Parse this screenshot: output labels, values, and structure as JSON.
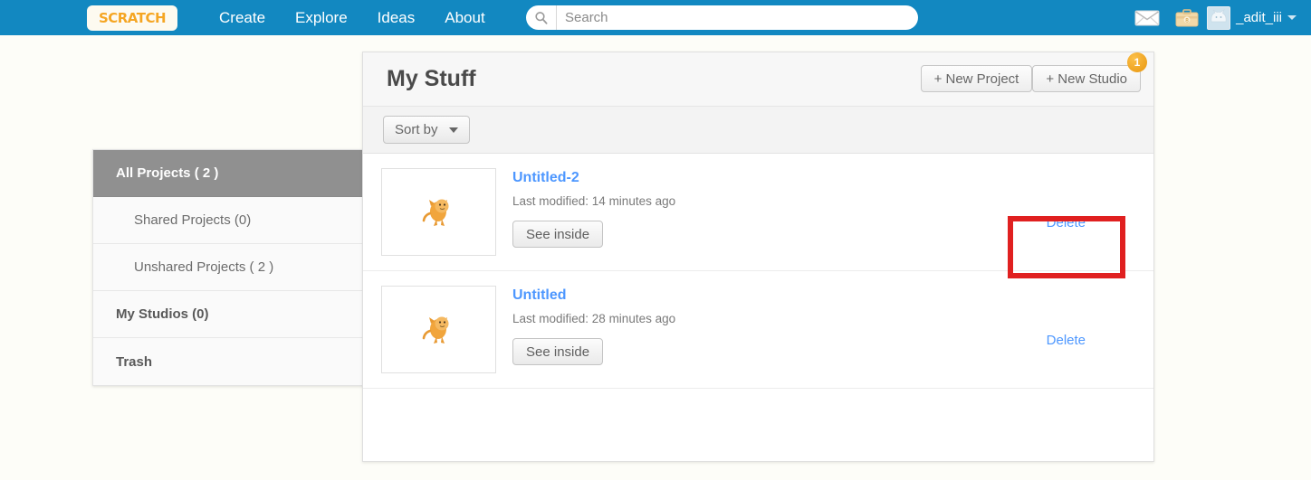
{
  "nav": {
    "logo_text": "SCRATCH",
    "logo_name": "scratch-logo",
    "links": [
      {
        "label": "Create"
      },
      {
        "label": "Explore"
      },
      {
        "label": "Ideas"
      },
      {
        "label": "About"
      }
    ],
    "search": {
      "placeholder": "Search",
      "value": "",
      "icon": "search-icon"
    },
    "messages_icon": "envelope-icon",
    "mystuff_icon": "briefcase-icon",
    "username": "_adit_iii",
    "avatar_icon": "avatar-cat-icon",
    "caret_icon": "chevron-down-icon"
  },
  "sidebar": {
    "items": [
      {
        "label": "All Projects ( 2 )",
        "selected": true,
        "indent": false,
        "bold": true
      },
      {
        "label": "Shared Projects (0)",
        "selected": false,
        "indent": true,
        "bold": false
      },
      {
        "label": "Unshared Projects ( 2 )",
        "selected": false,
        "indent": true,
        "bold": false
      },
      {
        "label": "My Studios (0)",
        "selected": false,
        "indent": false,
        "bold": true
      },
      {
        "label": "Trash",
        "selected": false,
        "indent": false,
        "bold": true
      }
    ]
  },
  "panel": {
    "title": "My Stuff",
    "new_project_label": "+ New Project",
    "new_studio_label": "+ New Studio",
    "studio_badge_count": "1",
    "sort_by_label": "Sort by",
    "sort_by_caret": "chevron-down-icon"
  },
  "projects": [
    {
      "title": "Untitled-2",
      "modified": "Last modified: 14 minutes ago",
      "see_inside_label": "See inside",
      "delete_label": "Delete",
      "thumbnail_icon": "scratch-cat-thumbnail"
    },
    {
      "title": "Untitled",
      "modified": "Last modified: 28 minutes ago",
      "see_inside_label": "See inside",
      "delete_label": "Delete",
      "thumbnail_icon": "scratch-cat-thumbnail"
    }
  ],
  "annotation": {
    "color": "#e02020",
    "target": "delete-link-row-1"
  }
}
